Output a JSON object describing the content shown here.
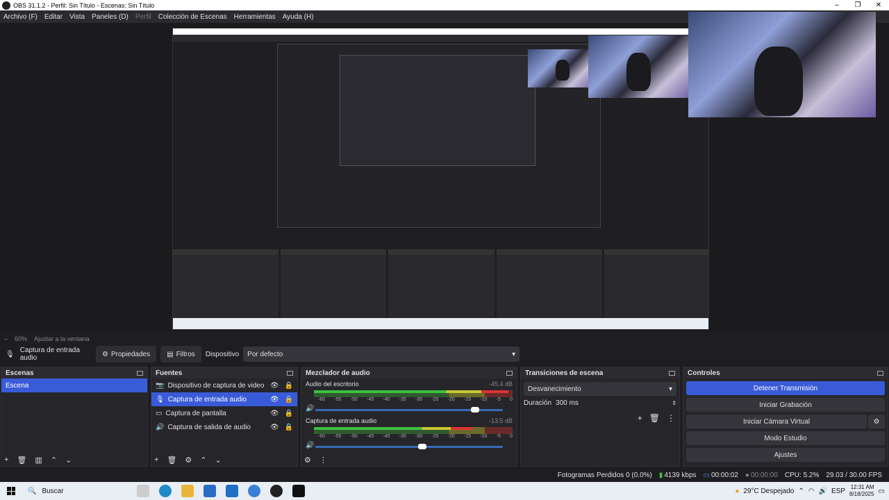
{
  "window": {
    "title": "OBS 31.1.2 - Perfil: Sin Título - Escenas: Sin Título",
    "controls": [
      "–",
      "❐",
      "✕"
    ]
  },
  "menu": [
    "Archivo (F)",
    "Editar",
    "Vista",
    "Paneles (D)",
    "Perfil",
    "Colección de Escenas",
    "Herramientas",
    "Ayuda (H)"
  ],
  "zoombar": {
    "dash": "–",
    "zoom": "60%",
    "fit": "Ajustar a la ventana"
  },
  "toolbar": {
    "source_name": "Captura de entrada audio",
    "properties": "Propiedades",
    "filters": "Filtros",
    "device_label": "Dispositivo",
    "device_value": "Por defecto"
  },
  "scenes": {
    "title": "Escenas",
    "items": [
      "Escena"
    ]
  },
  "sources": {
    "title": "Fuentes",
    "items": [
      "Dispositivo de captura de video",
      "Captura de entrada audio",
      "Captura de pantalla",
      "Captura de salida de audio"
    ]
  },
  "mixer": {
    "title": "Mezclador de audio",
    "scale": [
      "-60",
      "-55",
      "-50",
      "-45",
      "-40",
      "-35",
      "-30",
      "-25",
      "-20",
      "-15",
      "-10",
      "-5",
      "0"
    ],
    "channels": [
      {
        "name": "Audio del escritorio",
        "db": "-45.4 dB",
        "level": 0.98,
        "volume": 0.85
      },
      {
        "name": "Captura de entrada audio",
        "db": "-13.5 dB",
        "level": 0.8,
        "volume": 0.57
      }
    ]
  },
  "transitions": {
    "title": "Transiciones de escena",
    "selected": "Desvanecimiento",
    "duration_label": "Duración",
    "duration_value": "300 ms"
  },
  "controls": {
    "title": "Controles",
    "stop_stream": "Detener Transmisión",
    "start_recording": "Iniciar Grabación",
    "start_virtual_cam": "Iniciar Cámara Virtual",
    "studio_mode": "Modo Estudio",
    "settings": "Ajustes"
  },
  "status": {
    "dropped": "Fotogramas Perdidos 0 (0.0%)",
    "bitrate": "4139 kbps",
    "stream_time": "00:00:02",
    "rec_time": "00:00:00",
    "cpu": "CPU: 5.2%",
    "fps": "29.03 / 30.00 FPS"
  },
  "taskbar": {
    "search": "Buscar",
    "weather": "29°C  Despejado",
    "lang": "ESP",
    "time": "12:31 AM",
    "date": "8/18/2025"
  },
  "colors": {
    "accent": "#3a5bd8",
    "panel": "#26262a",
    "background": "#1e1e22"
  }
}
